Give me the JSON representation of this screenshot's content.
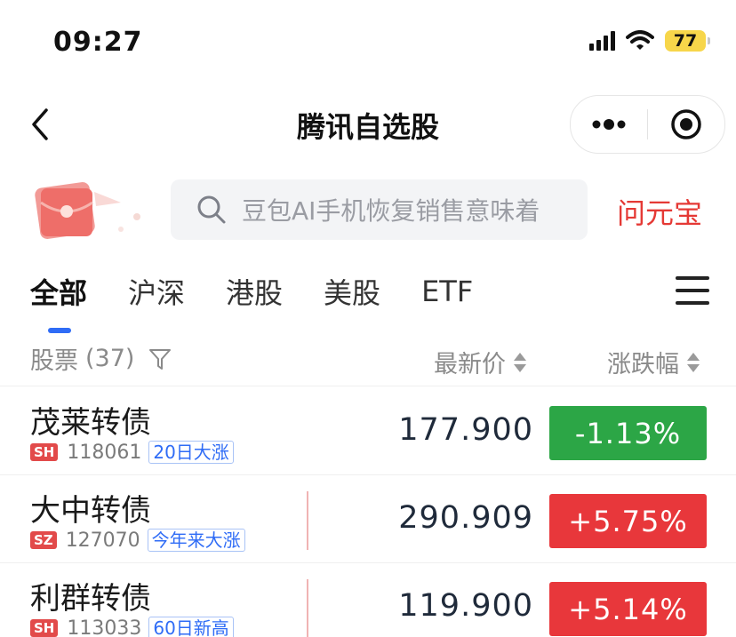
{
  "status_bar": {
    "time": "09:27",
    "battery": "77",
    "icons": [
      "signal-icon",
      "wifi-icon",
      "battery-icon"
    ],
    "battery_color": "#f7d64a"
  },
  "nav": {
    "title": "腾讯自选股",
    "icons": [
      "back-icon",
      "more-dots-icon",
      "close-target-icon"
    ]
  },
  "search": {
    "placeholder": "豆包AI手机恢复销售意味着",
    "ask_label": "问元宝",
    "icons": [
      "red-packet-icon",
      "search-icon"
    ],
    "ask_color": "#e53935"
  },
  "tabs": [
    {
      "label": "全部",
      "active": true
    },
    {
      "label": "沪深",
      "active": false
    },
    {
      "label": "港股",
      "active": false
    },
    {
      "label": "美股",
      "active": false
    },
    {
      "label": "ETF",
      "active": false
    }
  ],
  "list_header": {
    "stocks_label": "股票",
    "count": "(37)",
    "price_label": "最新价",
    "change_label": "涨跌幅",
    "icons": [
      "filter-icon",
      "sort-icon"
    ]
  },
  "rows": [
    {
      "name": "茂莱转债",
      "market": "SH",
      "code": "118061",
      "tag": "20日大涨",
      "price": "177.900",
      "change": "-1.13%",
      "direction": "down"
    },
    {
      "name": "大中转债",
      "market": "SZ",
      "code": "127070",
      "tag": "今年来大涨",
      "price": "290.909",
      "change": "+5.75%",
      "direction": "up"
    },
    {
      "name": "利群转债",
      "market": "SH",
      "code": "113033",
      "tag": "60日新高",
      "price": "119.900",
      "change": "+5.14%",
      "direction": "up"
    }
  ],
  "colors": {
    "up": "#e8373b",
    "down": "#2ca646",
    "accent": "#2f6cf6"
  }
}
